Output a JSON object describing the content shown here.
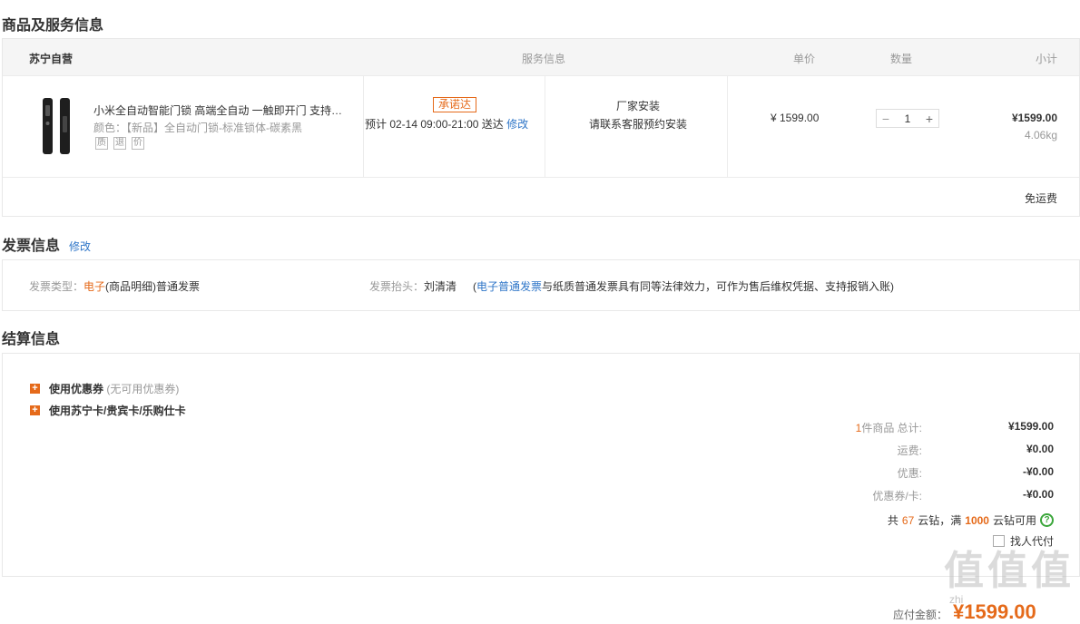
{
  "goods_section": {
    "title": "商品及服务信息",
    "header": {
      "store": "苏宁自营",
      "service": "服务信息",
      "unit_price": "单价",
      "quantity": "数量",
      "subtotal": "小计"
    },
    "product": {
      "name": "小米全自动智能门锁 高端全自动 一触即开门 支持…",
      "attr": "颜色：【新品】全自动门锁-标准锁体-碳素黑",
      "icons": [
        "质",
        "退",
        "价"
      ],
      "promise_badge": "承诺达",
      "delivery_text": "预计 02-14  09:00-21:00 送达",
      "delivery_edit": "修改",
      "install_line1": "厂家安装",
      "install_line2": "请联系客服预约安装",
      "unit_price": "¥ 1599.00",
      "quantity": "1",
      "subtotal": "¥1599.00",
      "weight": "4.06kg"
    },
    "shipping_note": "免运费"
  },
  "invoice_section": {
    "title": "发票信息",
    "edit": "修改",
    "type_label": "发票类型：",
    "type_highlight": "电子",
    "type_value": "(商品明细)普通发票",
    "header_label": "发票抬头：",
    "header_value": "刘清清",
    "note_open": "(",
    "note_link": "电子普通发票",
    "note_text": "与纸质普通发票具有同等法律效力，可作为售后维权凭据、支持报销入账)"
  },
  "settlement_section": {
    "title": "结算信息",
    "coupon_label": "使用优惠券",
    "coupon_note": "(无可用优惠券)",
    "card_label": "使用苏宁卡/贵宾卡/乐购仕卡",
    "items_count": "1",
    "items_label": "件商品 总计:",
    "total": "¥1599.00",
    "shipping_label": "运费:",
    "shipping": "¥0.00",
    "discount_label": "优惠:",
    "discount": "-¥0.00",
    "coupon_card_label": "优惠券/卡:",
    "coupon_card": "-¥0.00",
    "points_prefix": "共",
    "points_count": "67",
    "points_mid": "云钻，满",
    "points_threshold": "1000",
    "points_suffix": "云钻可用",
    "proxy_pay": "找人代付"
  },
  "payable": {
    "label": "应付金额：",
    "amount": "¥1599.00"
  },
  "watermark": {
    "glyphs": [
      "值",
      "值",
      "值"
    ],
    "sub": "zhi"
  },
  "colors": {
    "accent": "#e56a1a",
    "link": "#2f76c8",
    "help": "#3aa63a"
  }
}
